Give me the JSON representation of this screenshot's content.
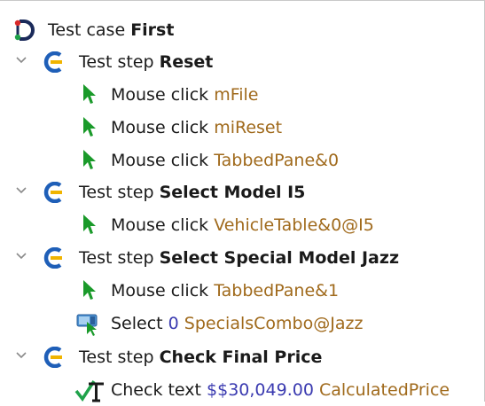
{
  "tree": {
    "root": {
      "prefix": "Test case ",
      "name": "First"
    },
    "steps": [
      {
        "prefix": "Test step ",
        "name": "Reset",
        "children": [
          {
            "kind": "click",
            "label": "Mouse click ",
            "target": "mFile"
          },
          {
            "kind": "click",
            "label": "Mouse click ",
            "target": "miReset"
          },
          {
            "kind": "click",
            "label": "Mouse click ",
            "target": "TabbedPane&0"
          }
        ]
      },
      {
        "prefix": "Test step ",
        "name": "Select Model I5",
        "children": [
          {
            "kind": "click",
            "label": "Mouse click ",
            "target": "VehicleTable&0@I5"
          }
        ]
      },
      {
        "prefix": "Test step ",
        "name": "Select Special Model Jazz",
        "children": [
          {
            "kind": "click",
            "label": "Mouse click ",
            "target": "TabbedPane&1"
          },
          {
            "kind": "select",
            "label": "Select ",
            "value": "0",
            "target": "SpecialsCombo@Jazz"
          }
        ]
      },
      {
        "prefix": "Test step ",
        "name": "Check Final Price",
        "children": [
          {
            "kind": "check",
            "label": "Check text ",
            "value": "$$30,049.00",
            "target": "CalculatedPrice"
          }
        ]
      }
    ]
  },
  "icons": {
    "root": "test-case-icon",
    "step": "test-step-icon",
    "click": "mouse-click-icon",
    "select": "select-combo-icon",
    "check": "check-text-icon",
    "expand": "chevron-down-icon"
  },
  "colors": {
    "target": "#a06a1c",
    "value": "#3a3ab0",
    "step_icon": "#1f5fb8",
    "step_icon_accent": "#f0b400",
    "cursor": "#1a9a2a",
    "root_icon_red": "#d92a2a",
    "root_icon_green": "#1fa24a",
    "root_icon_dark": "#1a2a5a"
  }
}
